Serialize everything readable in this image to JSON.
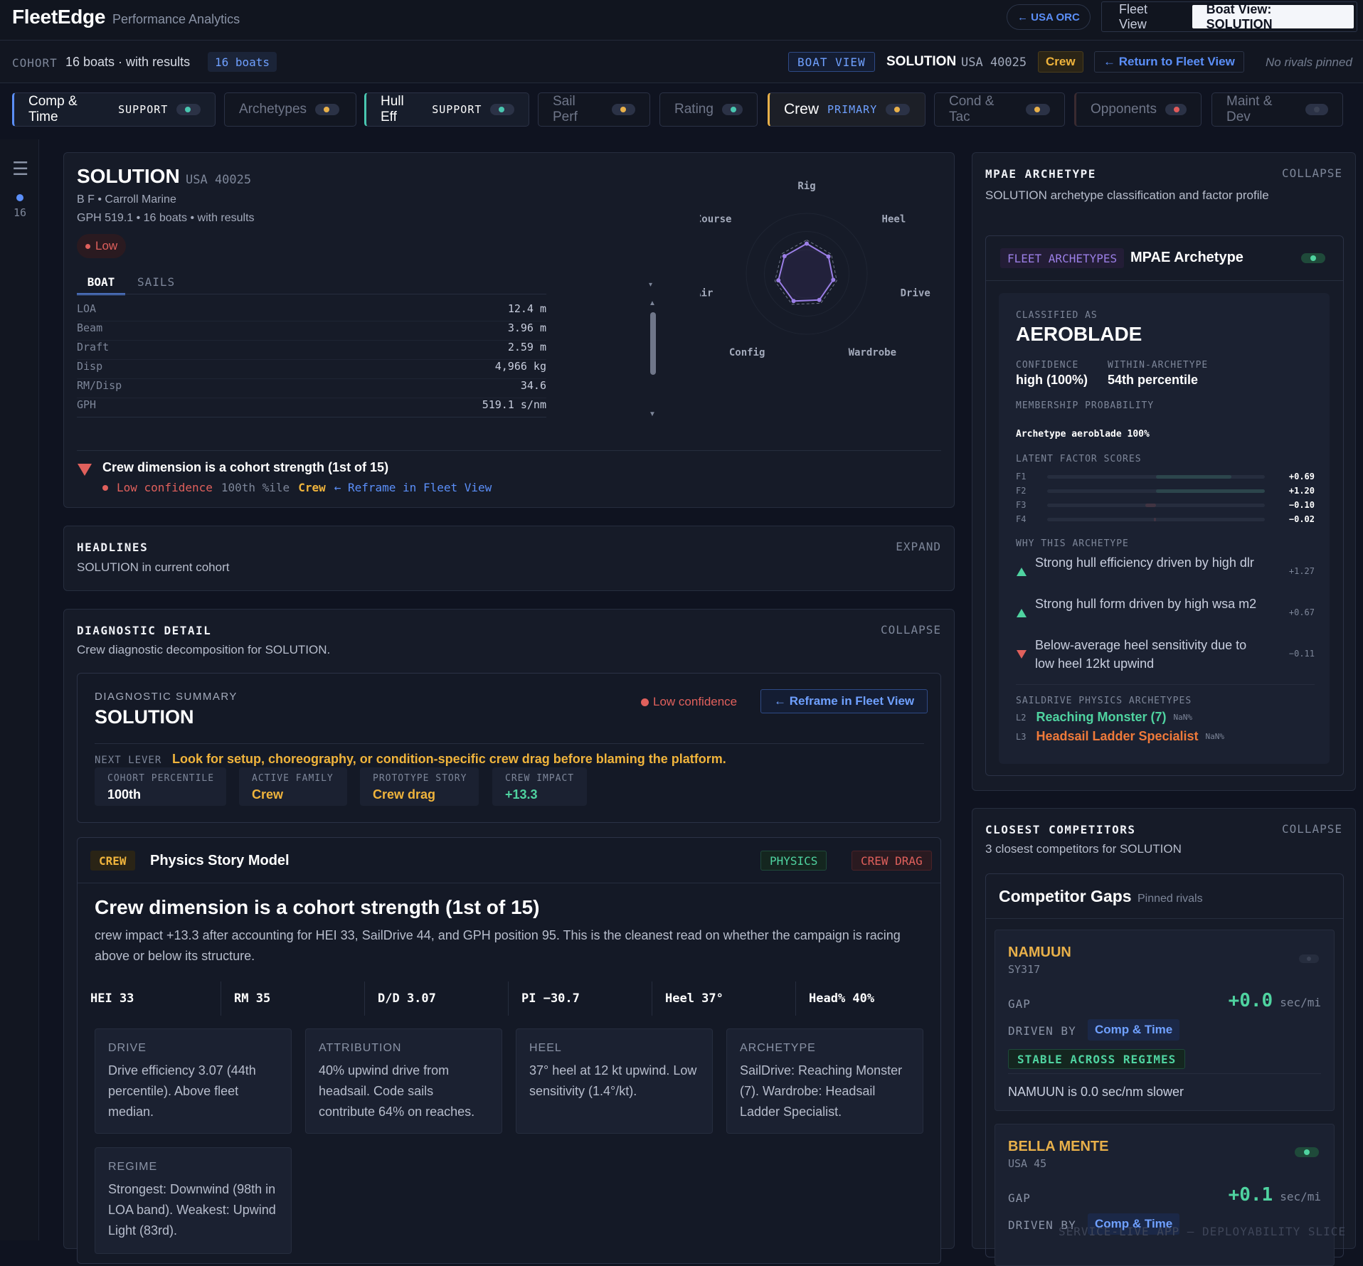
{
  "app": {
    "brand": "FleetEdge",
    "subtitle": "Performance Analytics",
    "back_label": "← USA ORC",
    "views": [
      "Fleet View",
      "Boat View: SOLUTION"
    ]
  },
  "cohort": {
    "label": "COHORT",
    "text": "16 boats · with results",
    "badge": "16 boats"
  },
  "boatview": {
    "badge": "BOAT VIEW",
    "name": "SOLUTION",
    "sail": "USA 40025",
    "crew": "Crew",
    "return": "← Return to Fleet View",
    "norivals": "No rivals pinned"
  },
  "tabs": [
    {
      "name": "Comp & Time",
      "sub": "SUPPORT",
      "dot": "#49c6b0"
    },
    {
      "name": "Archetypes",
      "sub": "",
      "dot": "#e8b04a"
    },
    {
      "name": "Hull Eff",
      "sub": "SUPPORT",
      "dot": "#49c6b0"
    },
    {
      "name": "Sail Perf",
      "sub": "",
      "dot": "#e8b04a"
    },
    {
      "name": "Rating",
      "sub": "",
      "dot": "#49c6b0"
    },
    {
      "name": "Crew",
      "sub": "PRIMARY",
      "dot": "#e8b04a"
    },
    {
      "name": "Cond & Tac",
      "sub": "",
      "dot": "#e8b04a"
    },
    {
      "name": "Opponents",
      "sub": "",
      "dot": "#e05a5a"
    },
    {
      "name": "Maint & Dev",
      "sub": "",
      "dot": "#3b4254"
    }
  ],
  "rail": {
    "count": "16"
  },
  "profile": {
    "name": "SOLUTION",
    "sail": "USA 40025",
    "designer": "B F • Carroll Marine",
    "meta": "GPH 519.1 • 16 boats • with results",
    "conf": "Low",
    "tabs": [
      "BOAT",
      "SAILS"
    ],
    "specs": [
      [
        "LOA",
        "12.4 m"
      ],
      [
        "Beam",
        "3.96 m"
      ],
      [
        "Draft",
        "2.59 m"
      ],
      [
        "Disp",
        "4,966 kg"
      ],
      [
        "RM/Disp",
        "34.6"
      ],
      [
        "GPH",
        "519.1 s/nm"
      ]
    ],
    "radar_labels": [
      "Rig",
      "Heel",
      "Drive",
      "Wardrobe",
      "Config",
      "HvyAir",
      "Course"
    ],
    "radar_values": [
      0.5,
      0.46,
      0.45,
      0.48,
      0.5,
      0.48,
      0.47
    ],
    "alert_title": "Crew dimension is a cohort strength (1st of 15)",
    "alert_conf": "Low confidence",
    "alert_pct": "100th %ile",
    "alert_crew": "Crew",
    "alert_link": "← Reframe in Fleet View"
  },
  "headlines": {
    "title": "HEADLINES",
    "sub": "SOLUTION in current cohort",
    "action": "EXPAND"
  },
  "diagnostic": {
    "title": "DIAGNOSTIC DETAIL",
    "sub": "Crew diagnostic decomposition for SOLUTION.",
    "action": "COLLAPSE",
    "summary_label": "DIAGNOSTIC SUMMARY",
    "summary_name": "SOLUTION",
    "conf": "Low confidence",
    "reframe": "← Reframe in Fleet View",
    "next_label": "NEXT LEVER",
    "next_text": "Look for setup, choreography, or condition-specific crew drag before blaming the platform.",
    "stats": [
      [
        "COHORT PERCENTILE",
        "100th"
      ],
      [
        "ACTIVE FAMILY",
        "Crew"
      ],
      [
        "PROTOTYPE STORY",
        "Crew drag"
      ],
      [
        "CREW IMPACT",
        "+13.3"
      ]
    ],
    "story_tag": "CREW",
    "story_title": "Physics Story Model",
    "tag_physics": "PHYSICS",
    "tag_drag": "CREW DRAG",
    "headline": "Crew dimension is a cohort strength (1st of 15)",
    "body": "crew impact +13.3 after accounting for HEI 33, SailDrive 44, and GPH position 95. This is the cleanest read on whether the campaign is racing above or below its structure.",
    "metrics": [
      "HEI 33",
      "RM 35",
      "D/D 3.07",
      "PI −30.7",
      "Heel 37°",
      "Head% 40%"
    ],
    "boxes": [
      [
        "DRIVE",
        "Drive efficiency 3.07 (44th percentile). Above fleet median."
      ],
      [
        "ATTRIBUTION",
        "40% upwind drive from headsail. Code sails contribute 64% on reaches."
      ],
      [
        "HEEL",
        "37° heel at 12 kt upwind. Low sensitivity (1.4°/kt)."
      ],
      [
        "ARCHETYPE",
        "SailDrive: Reaching Monster (7). Wardrobe: Headsail Ladder Specialist."
      ],
      [
        "REGIME",
        "Strongest: Downwind (98th in LOA band). Weakest: Upwind Light (83rd)."
      ]
    ]
  },
  "mpae": {
    "title": "MPAE ARCHETYPE",
    "sub": "SOLUTION archetype classification and factor profile",
    "action": "COLLAPSE",
    "tag": "FLEET ARCHETYPES",
    "name": "MPAE Archetype",
    "classified_label": "CLASSIFIED AS",
    "classified": "AEROBLADE",
    "confidence_label": "CONFIDENCE",
    "confidence": "high (100%)",
    "within_label": "WITHIN-ARCHETYPE",
    "within": "54th percentile",
    "membership_label": "MEMBERSHIP PROBABILITY",
    "membership": "Archetype aeroblade 100%",
    "latent_label": "LATENT FACTOR SCORES",
    "factors": [
      [
        "F1",
        "+0.69",
        0.69
      ],
      [
        "F2",
        "+1.20",
        1.2
      ],
      [
        "F3",
        "−0.10",
        -0.1
      ],
      [
        "F4",
        "−0.02",
        -0.02
      ]
    ],
    "why_label": "WHY THIS ARCHETYPE",
    "why": [
      [
        "up",
        "Strong hull efficiency driven by high dlr",
        "+1.27"
      ],
      [
        "up",
        "Strong hull form driven by high wsa m2",
        "+0.67"
      ],
      [
        "down",
        "Below-average heel sensitivity due to low heel 12kt upwind",
        "−0.11"
      ]
    ],
    "sd_label": "SAILDRIVE PHYSICS ARCHETYPES",
    "sd": [
      [
        "L2",
        "Reaching Monster (7)",
        "NaN%",
        "#4fd3a0"
      ],
      [
        "L3",
        "Headsail Ladder Specialist",
        "NaN%",
        "#f07a3a"
      ]
    ]
  },
  "competitors": {
    "title": "CLOSEST COMPETITORS",
    "sub": "3 closest competitors for SOLUTION",
    "action": "COLLAPSE",
    "panel_title": "Competitor Gaps",
    "panel_sub": "Pinned rivals",
    "list": [
      {
        "name": "NAMUUN",
        "sail": "SY317",
        "gap_label": "GAP",
        "gap": "+0.0",
        "unit": "sec/mi",
        "driven_label": "DRIVEN BY",
        "driven": "Comp & Time",
        "stable": "STABLE ACROSS REGIMES",
        "note": "NAMUUN is 0.0 sec/nm slower"
      },
      {
        "name": "BELLA MENTE",
        "sail": "USA 45",
        "gap_label": "GAP",
        "gap": "+0.1",
        "unit": "sec/mi",
        "driven_label": "DRIVEN BY",
        "driven": "Comp & Time"
      }
    ]
  },
  "footer": "SERVICE-LIVE APP — DEPLOYABILITY SLICE"
}
